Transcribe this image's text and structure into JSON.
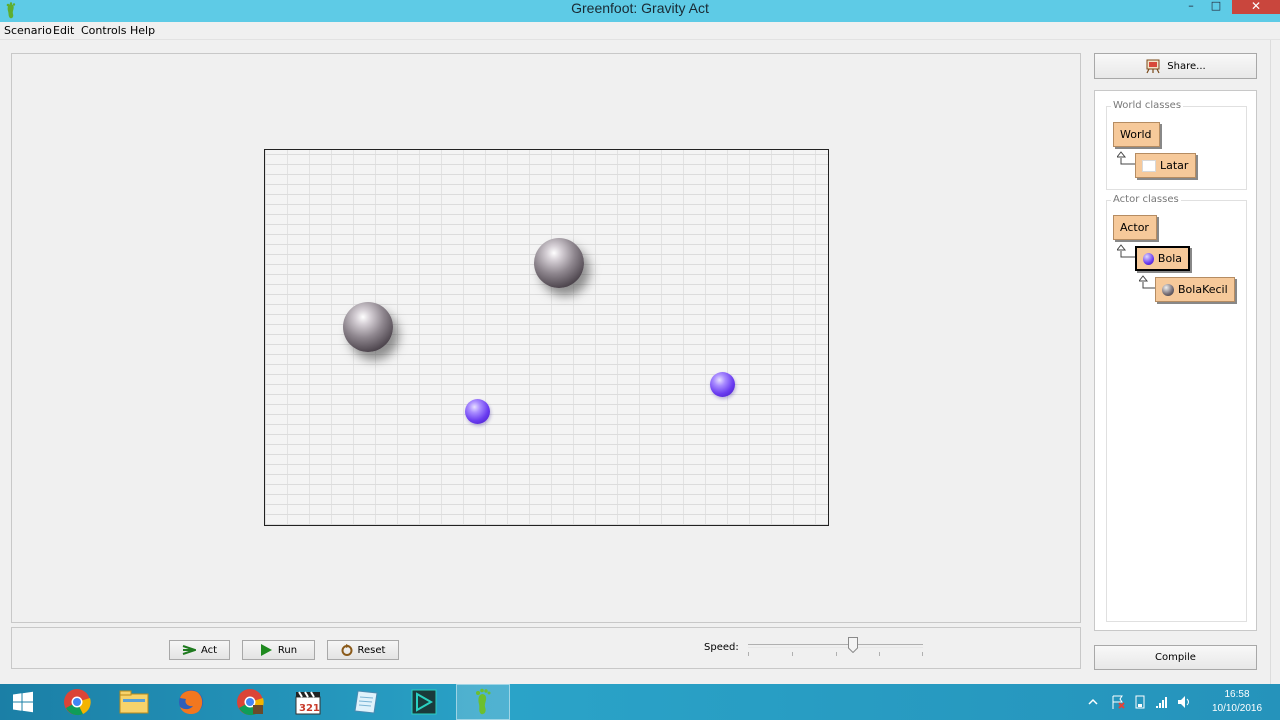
{
  "window": {
    "title": "Greenfoot: Gravity Act",
    "controls": {
      "minimize": "–",
      "maximize": "□",
      "close": "✕"
    }
  },
  "menu": [
    "Scenario",
    "Edit",
    "Controls",
    "Help"
  ],
  "world": {
    "actors": [
      {
        "class": "BolaKecil",
        "kind": "big-ball",
        "icon": "grey-ball"
      },
      {
        "class": "BolaKecil",
        "kind": "big-ball",
        "icon": "grey-ball"
      },
      {
        "class": "Bola",
        "kind": "small-ball",
        "icon": "purple-ball"
      },
      {
        "class": "Bola",
        "kind": "small-ball",
        "icon": "purple-ball"
      }
    ]
  },
  "controls": {
    "act_label": "Act",
    "run_label": "Run",
    "reset_label": "Reset",
    "speed_label": "Speed:",
    "speed_level": 0.6
  },
  "share_label": "Share...",
  "class_browser": {
    "world_group": "World classes",
    "world_classes": [
      "World",
      "Latar"
    ],
    "actor_group": "Actor classes",
    "actor_classes": [
      "Actor",
      "Bola",
      "BolaKecil"
    ],
    "selected": "Bola"
  },
  "compile_label": "Compile",
  "taskbar": {
    "apps": [
      "windows-start-icon",
      "chrome-icon",
      "file-explorer-icon",
      "firefox-icon",
      "chrome-alt-icon",
      "video-editor-icon",
      "notepad-icon",
      "media-player-icon",
      "greenfoot-icon"
    ],
    "active": "greenfoot-icon",
    "clock_time": "16:58",
    "clock_date": "10/10/2016"
  },
  "colors": {
    "titlebar": "#5ecbe6",
    "close_button": "#c9463d",
    "class_box": "#f6c99a",
    "taskbar": "#2aa3c8",
    "small_ball": "#6a3cf0"
  }
}
